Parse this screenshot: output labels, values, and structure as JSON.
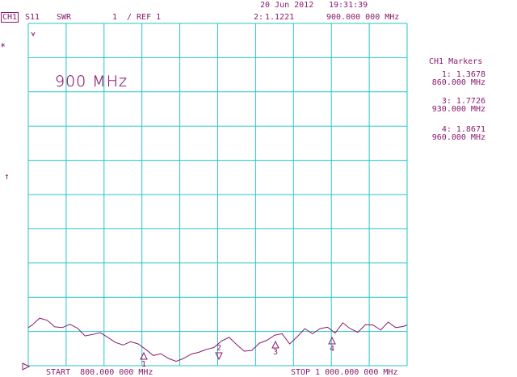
{
  "header": {
    "channel": "CH1",
    "param": "S11",
    "format": "SWR",
    "scale": "1",
    "ref": "/ REF 1",
    "date": "20 Jun 2012",
    "time": "19:31:39",
    "active_marker": "2:",
    "active_marker_value": "1.1221",
    "active_marker_freq": "900.000 000 MHz"
  },
  "annotation": "900 MHz",
  "side_symbols": {
    "star": "*",
    "up_arrow": "↑"
  },
  "markers_panel": {
    "title": "CH1 Markers",
    "entries": [
      {
        "value": "1: 1.3678",
        "freq": "860.000 MHz"
      },
      {
        "value": "3: 1.7726",
        "freq": "930.000 MHz"
      },
      {
        "value": "4: 1.8671",
        "freq": "960.000 MHz"
      }
    ]
  },
  "footer": {
    "start": "START  800.000 000 MHz",
    "stop": "STOP 1 000.000 000 MHz"
  },
  "colors": {
    "grid": "#24c6c8",
    "trace": "#8a1a6e",
    "text": "#8a1a6e"
  },
  "chart_data": {
    "type": "line",
    "x_unit": "MHz",
    "xlim": [
      800,
      1000
    ],
    "ylim": [
      1,
      2
    ],
    "grid": true,
    "marker_labels": [
      "1",
      "2",
      "3",
      "4"
    ],
    "markers": [
      {
        "label": "1",
        "x": 860,
        "y": 1.3678
      },
      {
        "label": "2",
        "x": 900,
        "y": 1.1221
      },
      {
        "label": "3",
        "x": 930,
        "y": 1.7726
      },
      {
        "label": "4",
        "x": 960,
        "y": 1.8671
      }
    ],
    "series": [
      {
        "x": [
          800,
          802,
          806,
          810,
          814,
          818,
          822,
          826,
          830,
          834,
          838,
          842,
          846,
          850,
          854,
          858,
          862,
          866,
          870,
          874,
          878,
          882,
          886,
          890,
          894,
          898,
          902,
          906,
          910,
          914,
          918,
          922,
          926,
          930,
          934,
          938,
          942,
          946,
          950,
          954,
          958,
          962,
          966,
          970,
          974,
          978,
          982,
          986,
          990,
          994,
          998,
          1000
        ],
        "y": [
          1.05,
          1.12,
          1.31,
          1.25,
          1.07,
          1.05,
          1.14,
          1.03,
          0.82,
          0.86,
          0.91,
          0.78,
          0.64,
          0.57,
          0.66,
          0.6,
          0.45,
          0.28,
          0.33,
          0.2,
          0.12,
          0.2,
          0.32,
          0.37,
          0.45,
          0.5,
          0.68,
          0.78,
          0.58,
          0.4,
          0.42,
          0.62,
          0.7,
          0.84,
          0.88,
          0.6,
          0.8,
          1.02,
          0.88,
          1.02,
          1.06,
          0.9,
          1.18,
          1.02,
          0.92,
          1.13,
          1.12,
          0.98,
          1.2,
          1.05,
          1.08,
          1.12
        ]
      }
    ]
  }
}
